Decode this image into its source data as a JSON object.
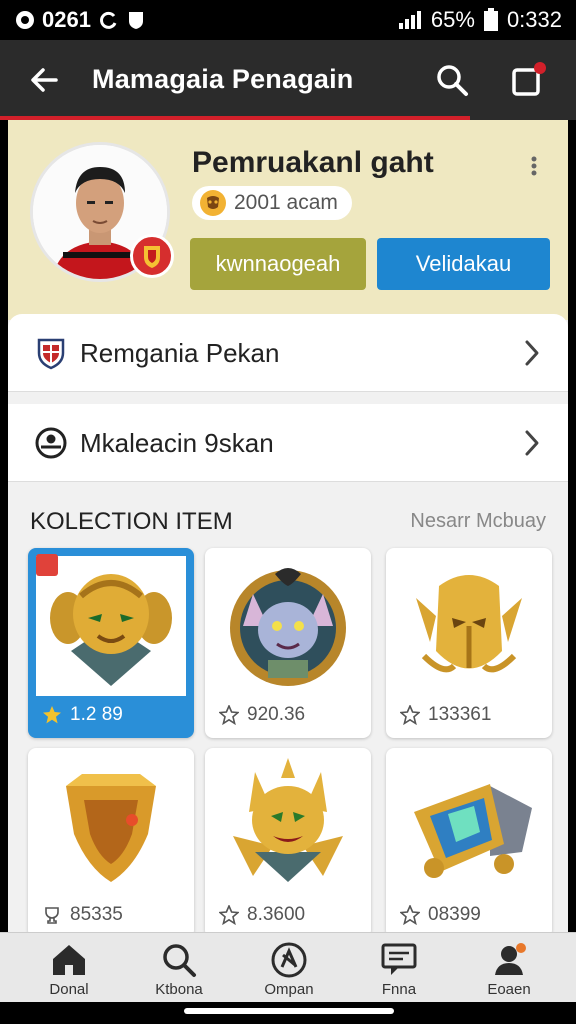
{
  "status_bar": {
    "left_text": "0261",
    "battery_percent": "65%",
    "time": "0:332"
  },
  "app_bar": {
    "title": "Mamagaia Penagain"
  },
  "profile": {
    "name": "Pemruakanl gaht",
    "points": "2001 acam",
    "button_primary": "kwnnaogeah",
    "button_secondary": "Velidakau"
  },
  "menu": [
    {
      "label": "Remgania Pekan",
      "icon": "shield-icon"
    },
    {
      "label": "Mkaleacin 9skan",
      "icon": "circle-user-icon"
    }
  ],
  "collection": {
    "title": "KOLECTION ITEM",
    "link": "Nesarr Mcbuay",
    "items": [
      {
        "value": "1.2 89",
        "icon": "star-icon",
        "selected": true,
        "art": "golden-robot-mask"
      },
      {
        "value": "920.36",
        "icon": "star-icon",
        "selected": false,
        "art": "purple-cat-badge"
      },
      {
        "value": "133361",
        "icon": "star-icon",
        "selected": false,
        "art": "golden-horned-helmet"
      },
      {
        "value": "85335",
        "icon": "trophy-icon",
        "selected": false,
        "art": "golden-shield"
      },
      {
        "value": "8.3600",
        "icon": "star-icon",
        "selected": false,
        "art": "golden-cat-emblem"
      },
      {
        "value": "08399",
        "icon": "star-icon",
        "selected": false,
        "art": "gem-cannon"
      }
    ]
  },
  "bottom_nav": [
    {
      "label": "Donal",
      "icon": "home-icon"
    },
    {
      "label": "Ktbona",
      "icon": "search-icon"
    },
    {
      "label": "Ompan",
      "icon": "compass-icon"
    },
    {
      "label": "Fnna",
      "icon": "chat-icon"
    },
    {
      "label": "Eoaen",
      "icon": "profile-icon"
    }
  ],
  "colors": {
    "accent_red": "#d2202a",
    "olive_button": "#a5a43c",
    "blue_button": "#1e86d0",
    "profile_bg": "#efe8c1"
  }
}
